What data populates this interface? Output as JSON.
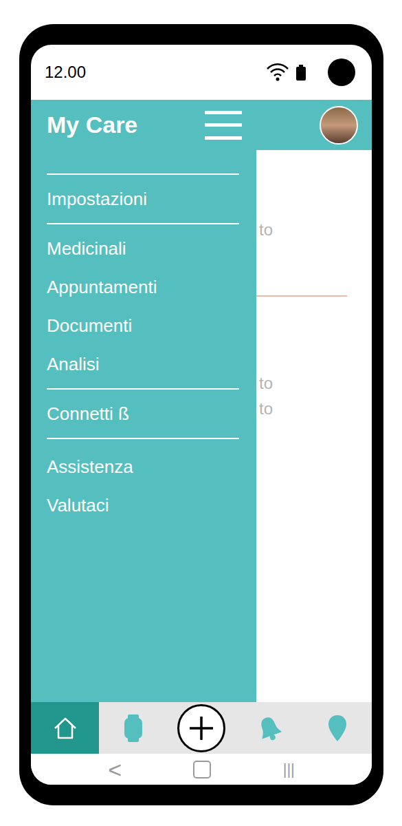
{
  "status_bar": {
    "time": "12.00"
  },
  "header": {
    "title": "My Care"
  },
  "drawer": {
    "open": true,
    "groups": [
      {
        "items": [
          {
            "label": "Impostazioni"
          }
        ]
      },
      {
        "items": [
          {
            "label": "Medicinali"
          },
          {
            "label": "Appuntamenti"
          },
          {
            "label": "Documenti"
          },
          {
            "label": "Analisi"
          }
        ]
      },
      {
        "items": [
          {
            "label": "Connetti ß"
          }
        ]
      },
      {
        "items": [
          {
            "label": "Assistenza"
          },
          {
            "label": "Valutaci"
          }
        ]
      }
    ]
  },
  "content": {
    "items": [
      {
        "lines": [
          "to"
        ]
      },
      {
        "lines": [
          "to",
          "to"
        ]
      }
    ]
  },
  "bottom_nav": [
    {
      "kind": "home",
      "selected": true
    },
    {
      "kind": "watch",
      "selected": false
    },
    {
      "kind": "add",
      "selected": false
    },
    {
      "kind": "bell",
      "selected": false
    },
    {
      "kind": "pin",
      "selected": false
    }
  ],
  "system_nav": {
    "back": "<",
    "recents": "|||"
  }
}
